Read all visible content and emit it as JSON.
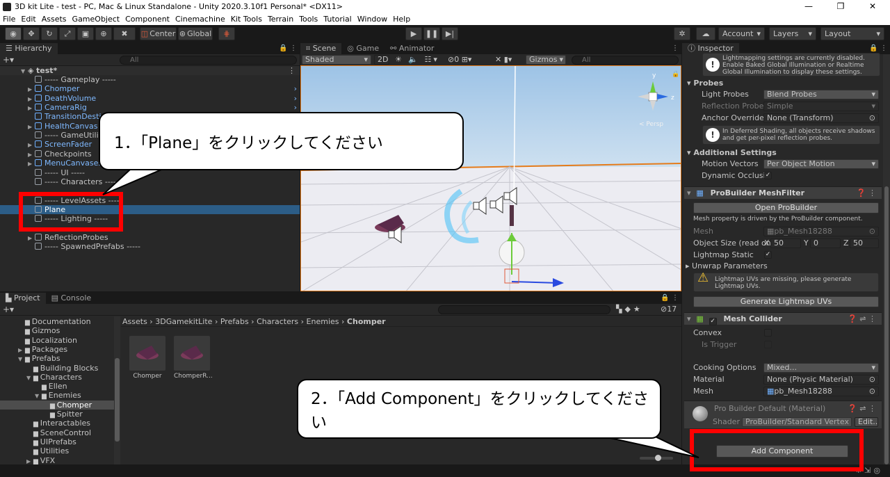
{
  "window": {
    "title": "3D kit Lite - test - PC, Mac & Linux Standalone - Unity 2020.3.10f1 Personal* <DX11>",
    "minimize": "—",
    "restore": "❐",
    "close": "✕"
  },
  "menu": [
    "File",
    "Edit",
    "Assets",
    "GameObject",
    "Component",
    "Cinemachine",
    "Kit Tools",
    "Terrain",
    "Tools",
    "Tutorial",
    "Window",
    "Help"
  ],
  "toolbar": {
    "center_label": "Center",
    "global_label": "Global",
    "account_label": "Account",
    "layers_label": "Layers",
    "layout_label": "Layout"
  },
  "hierarchy": {
    "tab": "Hierarchy",
    "search_placeholder": "All",
    "scene_name": "test*",
    "items": [
      {
        "label": "----- Gameplay -----",
        "blue": false,
        "fold": false
      },
      {
        "label": "Chomper",
        "blue": true,
        "fold": true
      },
      {
        "label": "DeathVolume",
        "blue": true,
        "fold": true
      },
      {
        "label": "CameraRig",
        "blue": true,
        "fold": true
      },
      {
        "label": "TransitionDestin",
        "blue": true,
        "fold": false
      },
      {
        "label": "HealthCanvas",
        "blue": true,
        "fold": true
      },
      {
        "label": "----- GameUtili",
        "blue": false,
        "fold": false
      },
      {
        "label": "ScreenFader",
        "blue": true,
        "fold": true
      },
      {
        "label": "Checkpoints",
        "blue": false,
        "fold": true
      },
      {
        "label": "MenuCanvases",
        "blue": true,
        "fold": true
      },
      {
        "label": "----- UI -----",
        "blue": false,
        "fold": false
      },
      {
        "label": "----- Characters -----",
        "blue": false,
        "fold": false
      },
      {
        "label": "",
        "blue": false,
        "fold": false
      },
      {
        "label": "----- LevelAssets -----",
        "blue": false,
        "fold": false
      },
      {
        "label": "Plane",
        "blue": false,
        "fold": false,
        "selected": true
      },
      {
        "label": "----- Lighting -----",
        "blue": false,
        "fold": false
      },
      {
        "label": "",
        "blue": false,
        "fold": false
      },
      {
        "label": "ReflectionProbes",
        "blue": false,
        "fold": true
      },
      {
        "label": "----- SpawnedPrefabs -----",
        "blue": false,
        "fold": false
      }
    ]
  },
  "scene": {
    "tabs": [
      "Scene",
      "Game",
      "Animator"
    ],
    "shading": "Shaded",
    "mode_2d": "2D",
    "hidden_count": "0",
    "gizmos": "Gizmos",
    "search_placeholder": "All",
    "persp_label": "< Persp",
    "axis_y": "y",
    "axis_z": "z"
  },
  "project": {
    "tabs": [
      "Project",
      "Console"
    ],
    "hidden_count": "17",
    "tree": [
      {
        "label": "Documentation",
        "indent": 0,
        "fold": false
      },
      {
        "label": "Gizmos",
        "indent": 0,
        "fold": false
      },
      {
        "label": "Localization",
        "indent": 0,
        "fold": false
      },
      {
        "label": "Packages",
        "indent": 0,
        "fold": true
      },
      {
        "label": "Prefabs",
        "indent": 0,
        "fold": true,
        "open": true
      },
      {
        "label": "Building Blocks",
        "indent": 1,
        "fold": false
      },
      {
        "label": "Characters",
        "indent": 1,
        "fold": true,
        "open": true
      },
      {
        "label": "Ellen",
        "indent": 2,
        "fold": false
      },
      {
        "label": "Enemies",
        "indent": 2,
        "fold": true,
        "open": true
      },
      {
        "label": "Chomper",
        "indent": 3,
        "fold": false,
        "selected": true
      },
      {
        "label": "Spitter",
        "indent": 3,
        "fold": false
      },
      {
        "label": "Interactables",
        "indent": 1,
        "fold": false
      },
      {
        "label": "SceneControl",
        "indent": 1,
        "fold": false
      },
      {
        "label": "UIPrefabs",
        "indent": 1,
        "fold": false
      },
      {
        "label": "Utilities",
        "indent": 1,
        "fold": false
      },
      {
        "label": "VFX",
        "indent": 1,
        "fold": true
      }
    ],
    "breadcrumb": [
      "Assets",
      "3DGamekitLite",
      "Prefabs",
      "Characters",
      "Enemies",
      "Chomper"
    ],
    "assets": [
      "Chomper",
      "ChomperR..."
    ]
  },
  "inspector": {
    "tab": "Inspector",
    "lightmap_warning": "Lightmapping settings are currently disabled. Enable Baked Global Illumination or Realtime Global Illumination to display these settings.",
    "probes_header": "Probes",
    "light_probes_label": "Light Probes",
    "light_probes_value": "Blend Probes",
    "reflection_probes_label": "Reflection Probes",
    "reflection_probes_value": "Simple",
    "anchor_override_label": "Anchor Override",
    "anchor_override_value": "None (Transform)",
    "deferred_info": "In Deferred Shading, all objects receive shadows and get per-pixel reflection probes.",
    "additional_header": "Additional Settings",
    "motion_vectors_label": "Motion Vectors",
    "motion_vectors_value": "Per Object Motion",
    "dynamic_occlusion_label": "Dynamic Occlusio",
    "pb_meshfilter_title": "ProBuilder MeshFilter",
    "open_probuilder": "Open ProBuilder",
    "mesh_property_note": "Mesh property is driven by the ProBuilder component.",
    "mesh_label": "Mesh",
    "mesh_value": "pb_Mesh18288",
    "object_size_label": "Object Size (read onl",
    "size_x_label": "X",
    "size_x": "50",
    "size_y_label": "Y",
    "size_y": "0",
    "size_z_label": "Z",
    "size_z": "50",
    "lightmap_static_label": "Lightmap Static",
    "unwrap_label": "Unwrap Parameters",
    "lightmap_uv_warning": "Lightmap UVs are missing, please generate Lightmap UVs.",
    "generate_uvs": "Generate Lightmap UVs",
    "mesh_collider_title": "Mesh Collider",
    "convex_label": "Convex",
    "is_trigger_label": "Is Trigger",
    "cooking_label": "Cooking Options",
    "cooking_value": "Mixed...",
    "material_label": "Material",
    "material_value": "None (Physic Material)",
    "collider_mesh_label": "Mesh",
    "collider_mesh_value": "pb_Mesh18288",
    "material_title": "Pro Builder Default (Material)",
    "shader_label": "Shader",
    "shader_value": "ProBuilder/Standard Vertex Co",
    "edit_label": "Edit...",
    "add_component": "Add Component"
  },
  "callouts": {
    "step1": "1．「Plane」をクリックしてください",
    "step2": "2．「Add Component」をクリックしてください"
  },
  "colors": {
    "highlight": "#ff0000",
    "selection": "#2c5d87",
    "prefab_blue": "#7fb9ff"
  }
}
